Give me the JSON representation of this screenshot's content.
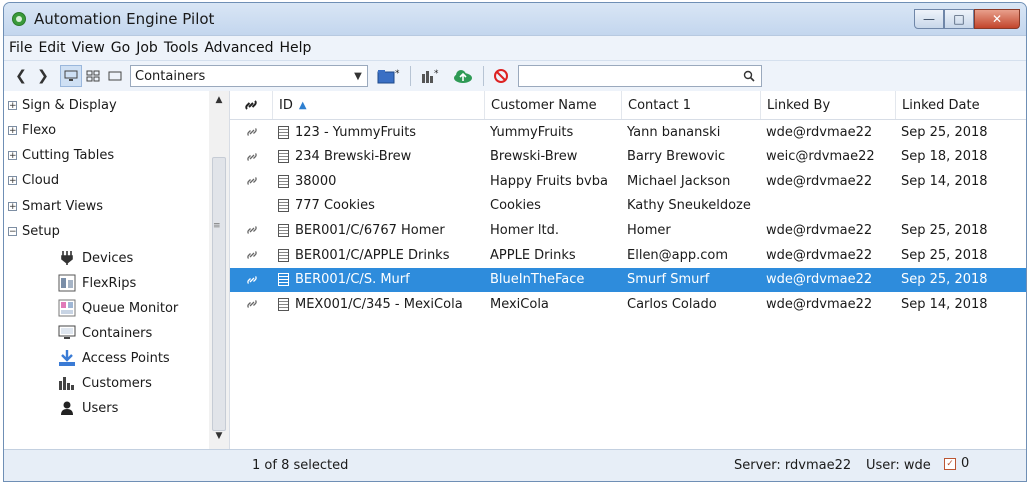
{
  "window": {
    "title": "Automation Engine Pilot"
  },
  "menu": [
    "File",
    "Edit",
    "View",
    "Go",
    "Job",
    "Tools",
    "Advanced",
    "Help"
  ],
  "toolbar": {
    "view_selector": "Containers",
    "search_value": ""
  },
  "sidebar": {
    "top_items": [
      "Sign & Display",
      "Flexo",
      "Cutting Tables",
      "Cloud",
      "Smart Views",
      "Setup"
    ],
    "setup_children": [
      {
        "label": "Devices",
        "icon": "devices-icon"
      },
      {
        "label": "FlexRips",
        "icon": "flexrips-icon"
      },
      {
        "label": "Queue Monitor",
        "icon": "queue-monitor-icon"
      },
      {
        "label": "Containers",
        "icon": "containers-icon"
      },
      {
        "label": "Access Points",
        "icon": "access-points-icon"
      },
      {
        "label": "Customers",
        "icon": "customers-icon"
      },
      {
        "label": "Users",
        "icon": "users-icon"
      }
    ]
  },
  "table": {
    "columns": [
      "ID",
      "Customer Name",
      "Contact 1",
      "Linked By",
      "Linked Date"
    ],
    "rows": [
      {
        "linked": true,
        "id": "123 - YummyFruits",
        "customer": "YummyFruits",
        "contact": "Yann bananski",
        "linked_by": "wde@rdvmae22",
        "date": "Sep 25, 2018"
      },
      {
        "linked": true,
        "id": "234 Brewski-Brew",
        "customer": "Brewski-Brew",
        "contact": "Barry Brewovic",
        "linked_by": "weic@rdvmae22",
        "date": "Sep 18, 2018"
      },
      {
        "linked": true,
        "id": "38000",
        "customer": "Happy Fruits bvba",
        "contact": "Michael Jackson",
        "linked_by": "wde@rdvmae22",
        "date": "Sep 14, 2018"
      },
      {
        "linked": false,
        "id": "777 Cookies",
        "customer": "Cookies",
        "contact": "Kathy Sneukeldoze",
        "linked_by": "",
        "date": ""
      },
      {
        "linked": true,
        "id": "BER001/C/6767 Homer",
        "customer": "Homer ltd.",
        "contact": "Homer",
        "linked_by": "wde@rdvmae22",
        "date": "Sep 25, 2018"
      },
      {
        "linked": true,
        "id": "BER001/C/APPLE Drinks",
        "customer": "APPLE Drinks",
        "contact": "Ellen@app.com",
        "linked_by": "wde@rdvmae22",
        "date": "Sep 25, 2018"
      },
      {
        "linked": true,
        "id": "BER001/C/S. Murf",
        "customer": "BlueInTheFace",
        "contact": "Smurf Smurf",
        "linked_by": "wde@rdvmae22",
        "date": "Sep 25, 2018"
      },
      {
        "linked": true,
        "id": "MEX001/C/345 - MexiCola",
        "customer": "MexiCola",
        "contact": "Carlos Colado",
        "linked_by": "wde@rdvmae22",
        "date": "Sep 14, 2018"
      }
    ],
    "selected_row": 6
  },
  "status": {
    "selection": "1 of 8 selected",
    "server": "Server: rdvmae22",
    "user": "User: wde",
    "count": "0"
  },
  "colors": {
    "selection": "#2e8cdc",
    "title_bg": "#c9dcf1"
  }
}
